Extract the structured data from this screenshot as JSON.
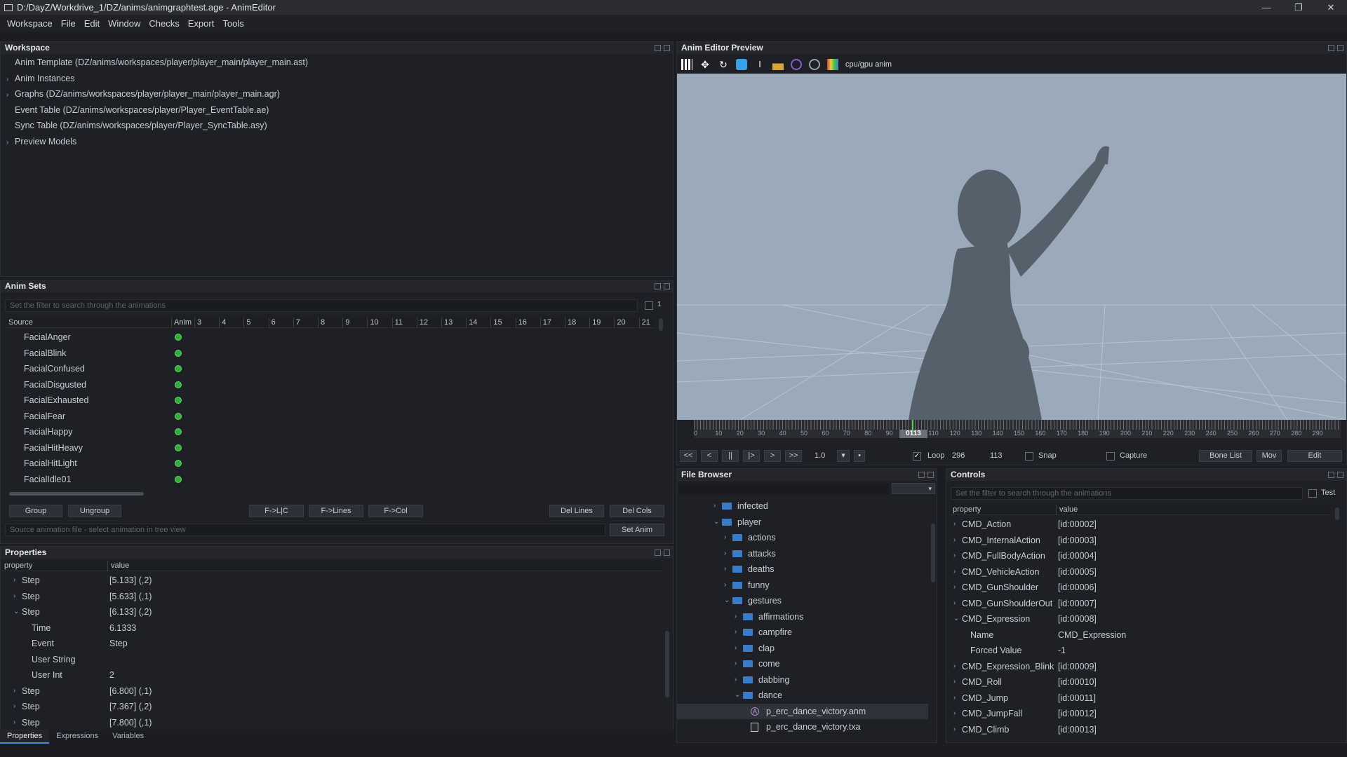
{
  "window": {
    "title": "D:/DayZ/Workdrive_1/DZ/anims/animgraphtest.age - AnimEditor"
  },
  "menu": [
    "Workspace",
    "File",
    "Edit",
    "Window",
    "Checks",
    "Export",
    "Tools"
  ],
  "workspace": {
    "title": "Workspace",
    "items": [
      {
        "label": "Anim Template (DZ/anims/workspaces/player/player_main/player_main.ast)",
        "expandable": false
      },
      {
        "label": "Anim Instances",
        "expandable": true
      },
      {
        "label": "Graphs (DZ/anims/workspaces/player/player_main/player_main.agr)",
        "expandable": true
      },
      {
        "label": "Event Table (DZ/anims/workspaces/player/Player_EventTable.ae)",
        "expandable": false
      },
      {
        "label": "Sync Table (DZ/anims/workspaces/player/Player_SyncTable.asy)",
        "expandable": false
      },
      {
        "label": "Preview Models",
        "expandable": true
      }
    ]
  },
  "animsets": {
    "title": "Anim Sets",
    "filter_placeholder": "Set the filter to search through the animations",
    "filter_count": "1",
    "col_source": "Source",
    "col_anim": "Anim",
    "col_nums": [
      "3",
      "4",
      "5",
      "6",
      "7",
      "8",
      "9",
      "10",
      "11",
      "12",
      "13",
      "14",
      "15",
      "16",
      "17",
      "18",
      "19",
      "20",
      "21"
    ],
    "rows": [
      "FacialAnger",
      "FacialBlink",
      "FacialConfused",
      "FacialDisgusted",
      "FacialExhausted",
      "FacialFear",
      "FacialHappy",
      "FacialHitHeavy",
      "FacialHitLight",
      "FacialIdle01"
    ],
    "buttons": {
      "group": "Group",
      "ungroup": "Ungroup",
      "flc": "F->L|C",
      "flines": "F->Lines",
      "fcol": "F->Col",
      "dellines": "Del Lines",
      "delcols": "Del Cols",
      "setanim": "Set Anim"
    },
    "source_placeholder": "Source animation file - select animation in tree view"
  },
  "properties": {
    "title": "Properties",
    "col_property": "property",
    "col_value": "value",
    "rows": [
      {
        "name": "Step",
        "value": "[5.133] (,2)",
        "indent": 1,
        "chev": "›"
      },
      {
        "name": "Step",
        "value": "[5.633] (,1)",
        "indent": 1,
        "chev": "›"
      },
      {
        "name": "Step",
        "value": "[6.133] (,2)",
        "indent": 1,
        "chev": "⌄"
      },
      {
        "name": "Time",
        "value": "6.1333",
        "indent": 2,
        "chev": ""
      },
      {
        "name": "Event",
        "value": "Step",
        "indent": 2,
        "chev": ""
      },
      {
        "name": "User String",
        "value": "",
        "indent": 2,
        "chev": ""
      },
      {
        "name": "User Int",
        "value": "2",
        "indent": 2,
        "chev": ""
      },
      {
        "name": "Step",
        "value": "[6.800] (,1)",
        "indent": 1,
        "chev": "›"
      },
      {
        "name": "Step",
        "value": "[7.367] (,2)",
        "indent": 1,
        "chev": "›"
      },
      {
        "name": "Step",
        "value": "[7.800] (,1)",
        "indent": 1,
        "chev": "›"
      }
    ],
    "tabs": [
      "Properties",
      "Expressions",
      "Variables"
    ]
  },
  "preview": {
    "title": "Anim Editor Preview",
    "mode_label": "cpu/gpu anim",
    "frame": "0113",
    "ruler_labels": [
      "0",
      "10",
      "20",
      "30",
      "40",
      "50",
      "60",
      "70",
      "80",
      "90",
      "100",
      "110",
      "120",
      "130",
      "140",
      "150",
      "160",
      "170",
      "180",
      "190",
      "200",
      "210",
      "220",
      "230",
      "240",
      "250",
      "260",
      "270",
      "280",
      "290"
    ],
    "controls": {
      "first": "<<",
      "prev": "<",
      "pause": "||",
      "stepf": "|>",
      "next": ">",
      "last": ">>",
      "speed": "1.0",
      "loop": "Loop",
      "end_frame": "296",
      "cur_frame": "113",
      "snap": "Snap",
      "capture": "Capture",
      "bonelist": "Bone List",
      "mov": "Mov",
      "edit": "Edit"
    }
  },
  "filebrowser": {
    "title": "File Browser",
    "items": [
      {
        "label": "infected",
        "level": 0,
        "chev": "›",
        "type": "folder"
      },
      {
        "label": "player",
        "level": 0,
        "chev": "⌄",
        "type": "folder"
      },
      {
        "label": "actions",
        "level": 1,
        "chev": "›",
        "type": "folder"
      },
      {
        "label": "attacks",
        "level": 1,
        "chev": "›",
        "type": "folder"
      },
      {
        "label": "deaths",
        "level": 1,
        "chev": "›",
        "type": "folder"
      },
      {
        "label": "funny",
        "level": 1,
        "chev": "›",
        "type": "folder"
      },
      {
        "label": "gestures",
        "level": 1,
        "chev": "⌄",
        "type": "folder"
      },
      {
        "label": "affirmations",
        "level": 2,
        "chev": "›",
        "type": "folder"
      },
      {
        "label": "campfire",
        "level": 2,
        "chev": "›",
        "type": "folder"
      },
      {
        "label": "clap",
        "level": 2,
        "chev": "›",
        "type": "folder"
      },
      {
        "label": "come",
        "level": 2,
        "chev": "›",
        "type": "folder"
      },
      {
        "label": "dabbing",
        "level": 2,
        "chev": "›",
        "type": "folder"
      },
      {
        "label": "dance",
        "level": 2,
        "chev": "⌄",
        "type": "folder"
      },
      {
        "label": "p_erc_dance_victory.anm",
        "level": 3,
        "chev": "",
        "type": "anm"
      },
      {
        "label": "p_erc_dance_victory.txa",
        "level": 3,
        "chev": "",
        "type": "txa"
      }
    ]
  },
  "controls_panel": {
    "title": "Controls",
    "filter_placeholder": "Set the filter to search through the animations",
    "test_label": "Test",
    "col_property": "property",
    "col_value": "value",
    "rows": [
      {
        "name": "CMD_Action",
        "value": "[id:00002]",
        "chev": "›",
        "indent": 0
      },
      {
        "name": "CMD_InternalAction",
        "value": "[id:00003]",
        "chev": "›",
        "indent": 0
      },
      {
        "name": "CMD_FullBodyAction",
        "value": "[id:00004]",
        "chev": "›",
        "indent": 0
      },
      {
        "name": "CMD_VehicleAction",
        "value": "[id:00005]",
        "chev": "›",
        "indent": 0
      },
      {
        "name": "CMD_GunShoulder",
        "value": "[id:00006]",
        "chev": "›",
        "indent": 0
      },
      {
        "name": "CMD_GunShoulderOut",
        "value": "[id:00007]",
        "chev": "›",
        "indent": 0
      },
      {
        "name": "CMD_Expression",
        "value": "[id:00008]",
        "chev": "⌄",
        "indent": 0
      },
      {
        "name": "Name",
        "value": "CMD_Expression",
        "chev": "",
        "indent": 1
      },
      {
        "name": "Forced Value",
        "value": "-1",
        "chev": "",
        "indent": 1
      },
      {
        "name": "CMD_Expression_Blink",
        "value": "[id:00009]",
        "chev": "›",
        "indent": 0
      },
      {
        "name": "CMD_Roll",
        "value": "[id:00010]",
        "chev": "›",
        "indent": 0
      },
      {
        "name": "CMD_Jump",
        "value": "[id:00011]",
        "chev": "›",
        "indent": 0
      },
      {
        "name": "CMD_JumpFall",
        "value": "[id:00012]",
        "chev": "›",
        "indent": 0
      },
      {
        "name": "CMD_Climb",
        "value": "[id:00013]",
        "chev": "›",
        "indent": 0
      }
    ]
  }
}
